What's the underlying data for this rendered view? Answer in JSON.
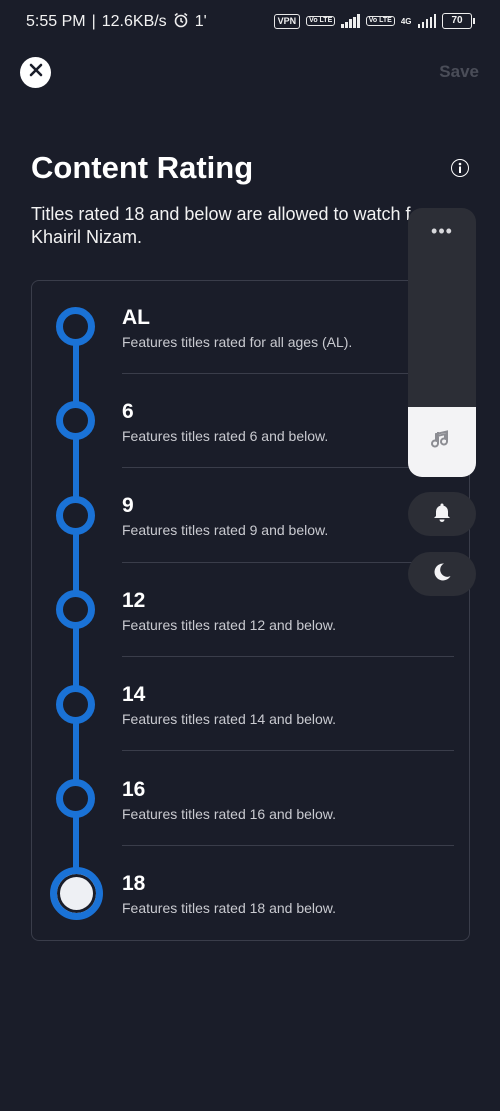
{
  "status_bar": {
    "time": "5:55 PM",
    "speed": "12.6KB/s",
    "extra": "1'",
    "vpn": "VPN",
    "volte1": "Vo LTE",
    "volte2": "Vo LTE",
    "network": "4G",
    "battery": "70"
  },
  "header": {
    "save_label": "Save",
    "title": "Content Rating",
    "subtitle": "Titles rated 18 and below are allowed to watch for Khairil Nizam.",
    "subtitle_line1": "Titles rated 18 and below are allowed to watch f",
    "subtitle_line2": "Khairil Nizam."
  },
  "ratings": [
    {
      "label": "AL",
      "desc": "Features titles rated for all ages (AL)."
    },
    {
      "label": "6",
      "desc": "Features titles rated 6 and below."
    },
    {
      "label": "9",
      "desc": "Features titles rated 9 and below."
    },
    {
      "label": "12",
      "desc": "Features titles rated 12 and below."
    },
    {
      "label": "14",
      "desc": "Features titles rated 14 and below."
    },
    {
      "label": "16",
      "desc": "Features titles rated 16 and below."
    },
    {
      "label": "18",
      "desc": "Features titles rated 18 and below."
    }
  ],
  "selected_rating": "18",
  "volume_overlay": {
    "dots": "•••",
    "level": 0.26,
    "icons": [
      "music-note-icon",
      "bell-icon",
      "moon-icon"
    ]
  },
  "colors": {
    "background": "#1a1d29",
    "accent": "#1a72d6",
    "save_disabled": "#4a4d58"
  }
}
